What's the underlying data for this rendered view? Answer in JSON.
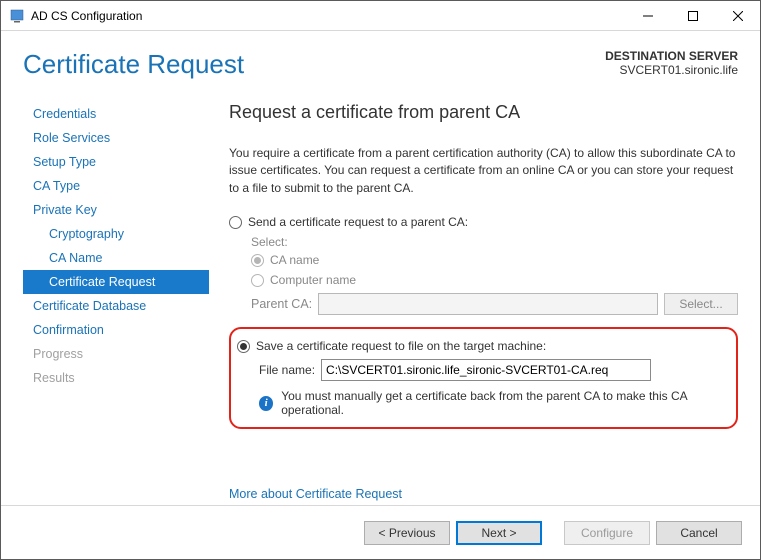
{
  "window": {
    "title": "AD CS Configuration"
  },
  "header": {
    "title": "Certificate Request",
    "dest_label": "DESTINATION SERVER",
    "dest_server": "SVCERT01.sironic.life"
  },
  "nav": {
    "items": [
      {
        "label": "Credentials"
      },
      {
        "label": "Role Services"
      },
      {
        "label": "Setup Type"
      },
      {
        "label": "CA Type"
      },
      {
        "label": "Private Key"
      },
      {
        "label": "Cryptography",
        "sub": true
      },
      {
        "label": "CA Name",
        "sub": true
      },
      {
        "label": "Certificate Request",
        "sub": true,
        "selected": true
      },
      {
        "label": "Certificate Database"
      },
      {
        "label": "Confirmation"
      },
      {
        "label": "Progress",
        "disabled": true
      },
      {
        "label": "Results",
        "disabled": true
      }
    ]
  },
  "content": {
    "heading": "Request a certificate from parent CA",
    "intro": "You require a certificate from a parent certification authority (CA) to allow this subordinate CA to issue certificates. You can request a certificate from an online CA or you can store your request to a file to submit to the parent CA.",
    "option1": {
      "label": "Send a certificate request to a parent CA:",
      "select_label": "Select:",
      "ca_name": "CA name",
      "computer_name": "Computer name",
      "parent_ca_label": "Parent CA:",
      "parent_ca_value": "",
      "select_button": "Select..."
    },
    "option2": {
      "label": "Save a certificate request to file on the target machine:",
      "file_label": "File name:",
      "file_value": "C:\\SVCERT01.sironic.life_sironic-SVCERT01-CA.req",
      "info": "You must manually get a certificate back from the parent CA to make this CA operational."
    },
    "more_link": "More about Certificate Request"
  },
  "footer": {
    "previous": "< Previous",
    "next": "Next >",
    "configure": "Configure",
    "cancel": "Cancel"
  }
}
